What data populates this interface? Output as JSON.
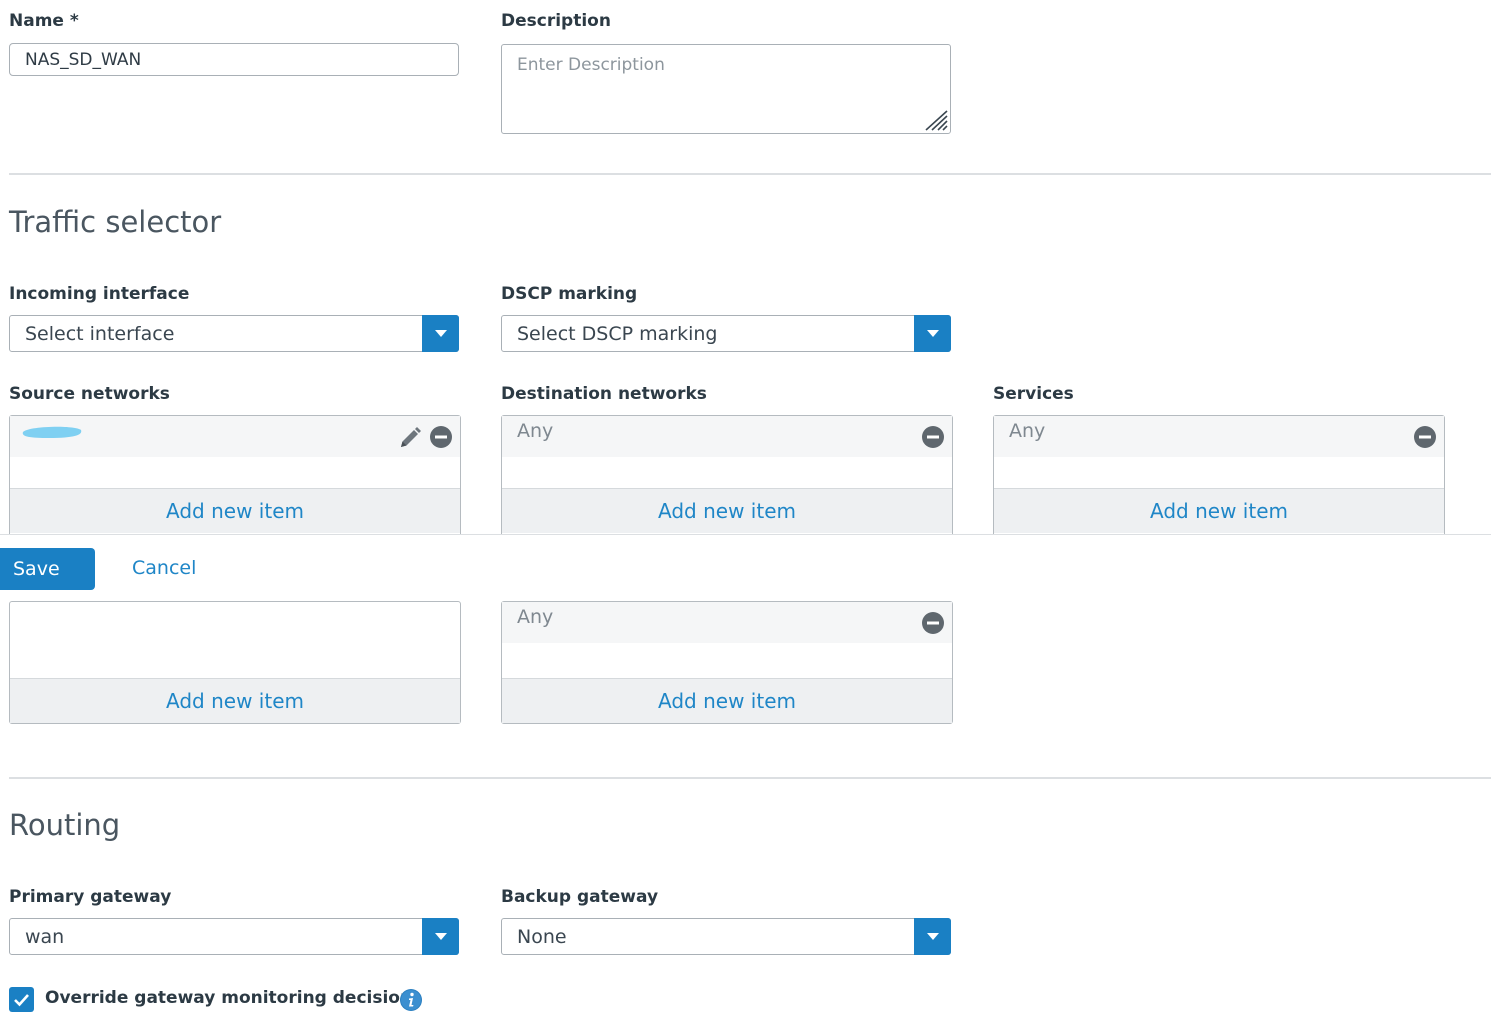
{
  "general": {
    "name_label": "Name *",
    "name_value": "NAS_SD_WAN",
    "description_label": "Description",
    "description_placeholder": "Enter Description"
  },
  "traffic_selector": {
    "title": "Traffic selector",
    "incoming_interface_label": "Incoming interface",
    "incoming_interface_value": "Select interface",
    "dscp_label": "DSCP marking",
    "dscp_value": "Select DSCP marking",
    "source_networks_label": "Source networks",
    "destination_networks_label": "Destination networks",
    "services_label": "Services",
    "any_text": "Any",
    "add_new_item": "Add new item"
  },
  "action_bar": {
    "save_label": "Save",
    "cancel_label": "Cancel"
  },
  "routing": {
    "title": "Routing",
    "primary_gateway_label": "Primary gateway",
    "primary_gateway_value": "wan",
    "backup_gateway_label": "Backup gateway",
    "backup_gateway_value": "None",
    "override_label": "Override gateway monitoring decision",
    "override_checked": true
  },
  "colors": {
    "accent": "#1a80c4",
    "link": "#1f86c7",
    "redaction": "#7fd0f2"
  },
  "icons": [
    "chevron-down-icon",
    "pencil-icon",
    "minus-circle-icon",
    "checkmark-icon",
    "info-icon",
    "resize-grip-icon"
  ]
}
